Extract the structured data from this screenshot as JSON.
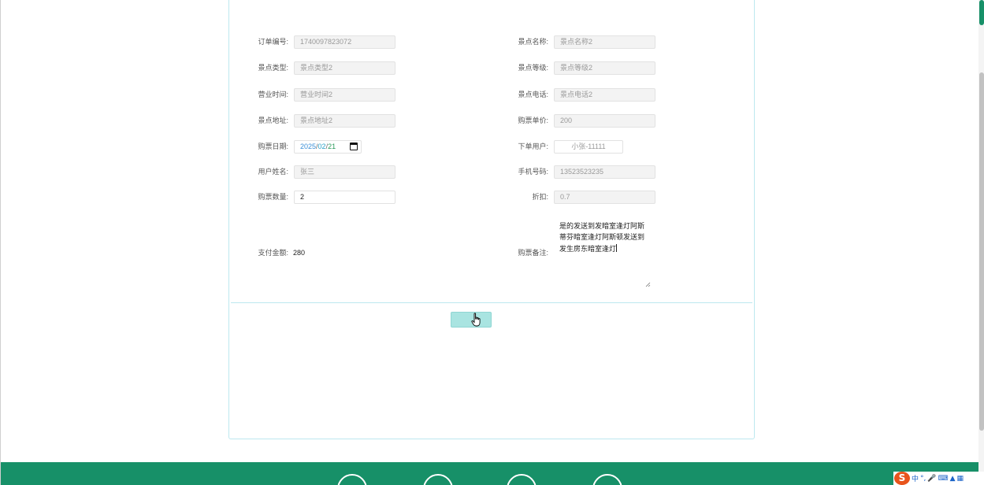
{
  "form": {
    "fields_left": [
      {
        "label": "订单编号:",
        "value": "1740097823072",
        "kind": "readonly"
      },
      {
        "label": "景点类型:",
        "value": "景点类型2",
        "kind": "readonly"
      },
      {
        "label": "营业时间:",
        "value": "营业时间2",
        "kind": "readonly"
      },
      {
        "label": "景点地址:",
        "value": "景点地址2",
        "kind": "readonly"
      },
      {
        "label": "购票日期:",
        "value": "2025/02/21",
        "kind": "date"
      },
      {
        "label": "用户姓名:",
        "value": "张三",
        "kind": "readonly"
      },
      {
        "label": "购票数量:",
        "value": "2",
        "kind": "editable"
      }
    ],
    "fields_right": [
      {
        "label": "景点名称:",
        "value": "景点名称2",
        "kind": "readonly"
      },
      {
        "label": "景点等级:",
        "value": "景点等级2",
        "kind": "readonly"
      },
      {
        "label": "景点电话:",
        "value": "景点电话2",
        "kind": "readonly"
      },
      {
        "label": "购票单价:",
        "value": "200",
        "kind": "readonly"
      },
      {
        "label": "下单用户:",
        "value": "小张-11111",
        "kind": "select"
      },
      {
        "label": "手机号码:",
        "value": "13523523235",
        "kind": "readonly"
      },
      {
        "label": "折扣:",
        "value": "0.7",
        "kind": "readonly"
      }
    ],
    "date_parts": {
      "year": "2025",
      "month": "02",
      "day": "21",
      "sep": "/"
    },
    "payment": {
      "label": "支付金额:",
      "value": "280"
    },
    "remark": {
      "label": "购票备注:",
      "value": "是的发送到发暗室逢灯阿斯蒂芬暗室逢灯阿斯顿发送到发生房东暗室逢灯"
    },
    "submit_label": ""
  },
  "ime": {
    "label_zh": "中",
    "punct": "°,"
  },
  "colors": {
    "footer": "#179068",
    "submit": "#a9e4e1",
    "panel_border": "#bde8ef"
  }
}
